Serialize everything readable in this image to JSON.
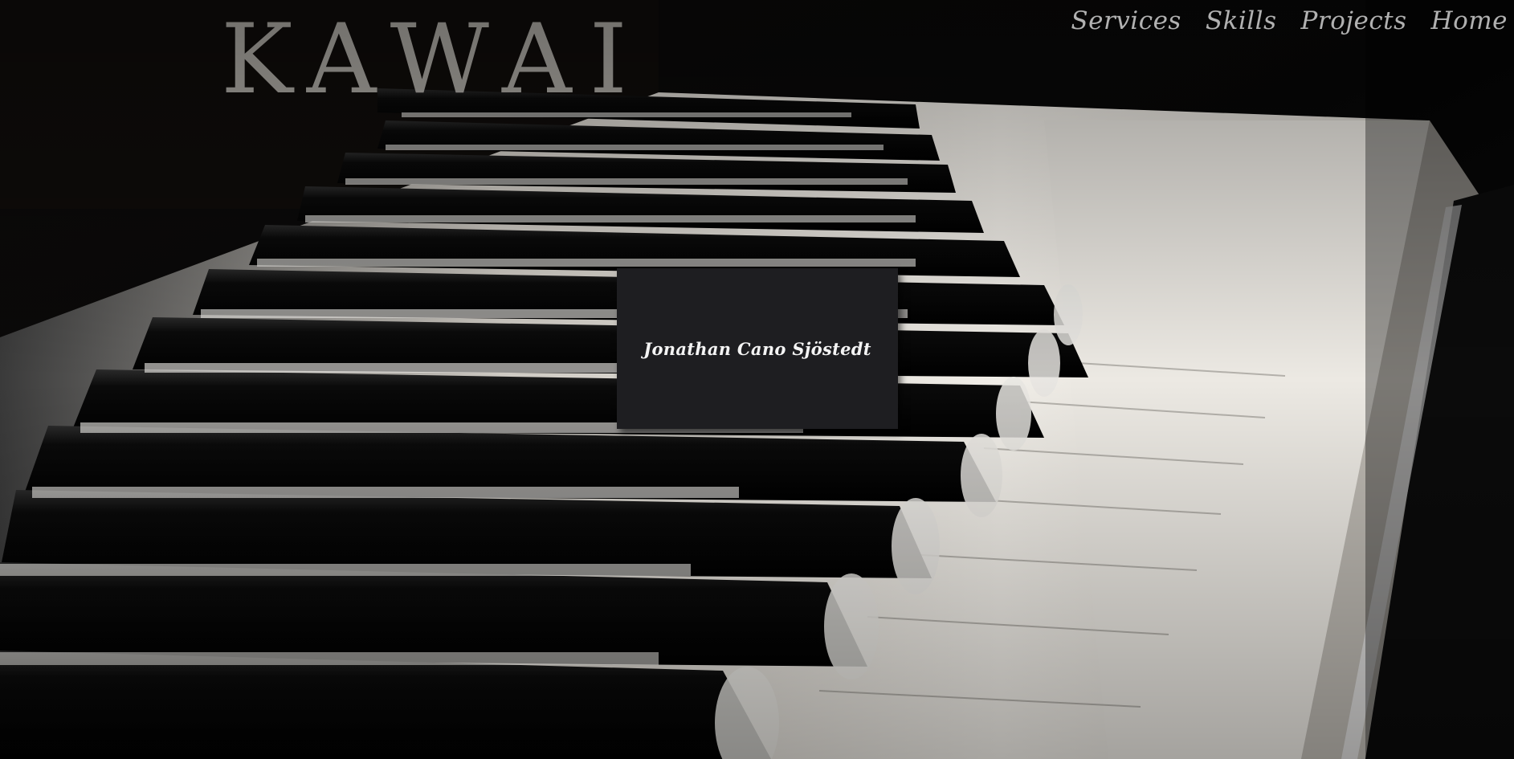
{
  "nav": {
    "items": [
      {
        "label": "Services"
      },
      {
        "label": "Skills"
      },
      {
        "label": "Projects"
      },
      {
        "label": "Home"
      }
    ]
  },
  "hero": {
    "brand_text": "KAWAI",
    "name": "Jonathan Cano Sjöstedt"
  },
  "colors": {
    "card_background": "#1e1e21",
    "nav_text": "#cfcfcf",
    "name_text": "#f4f4f4"
  }
}
